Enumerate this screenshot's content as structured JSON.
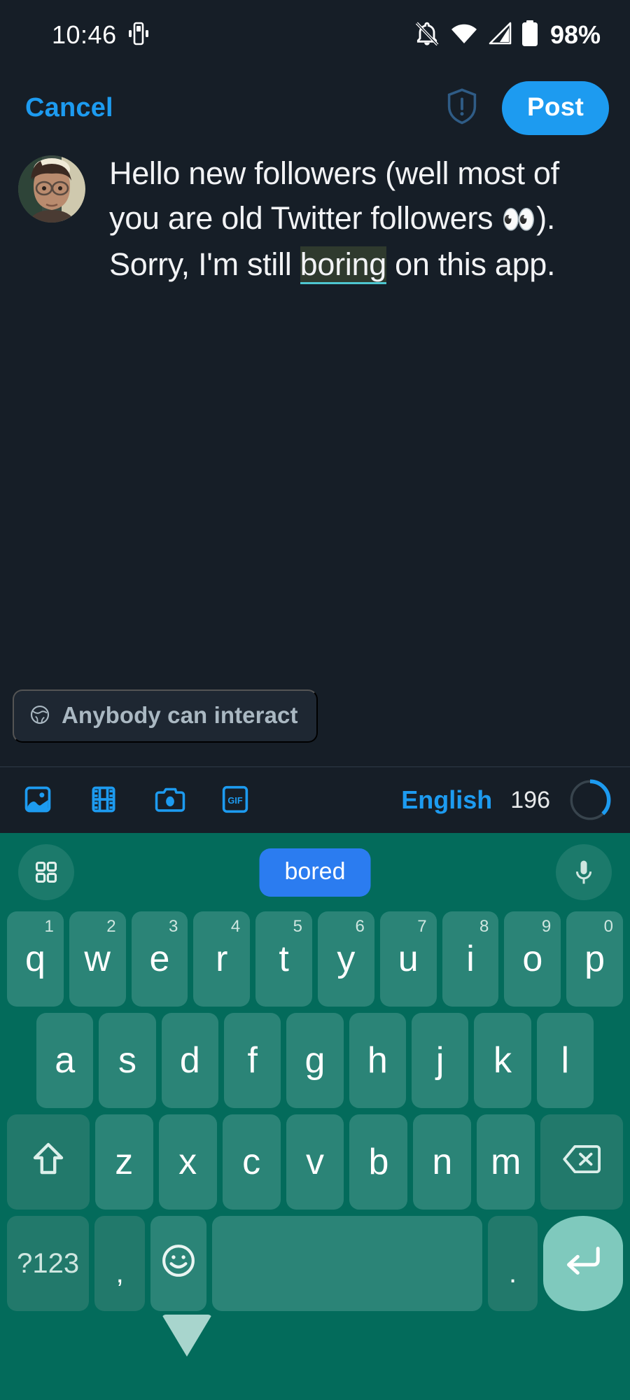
{
  "status_bar": {
    "time": "10:46",
    "battery_percent": "98%",
    "icons": [
      "vibrate-icon",
      "mute-notifications-icon",
      "wifi-icon",
      "cellular-signal-icon",
      "battery-icon"
    ]
  },
  "header": {
    "cancel_label": "Cancel",
    "post_label": "Post",
    "shield_icon": "shield-alert-icon"
  },
  "composer": {
    "avatar_alt": "user-avatar",
    "text_segments": [
      {
        "text": "Hello new followers (well most of you are old Twitter followers ",
        "highlight": false
      },
      {
        "text": "👀",
        "highlight": false,
        "emoji": true
      },
      {
        "text": "). Sorry, I'm still ",
        "highlight": false
      },
      {
        "text": "boring",
        "highlight": true
      },
      {
        "text": " on this app.",
        "highlight": false
      }
    ],
    "full_text": "Hello new followers (well most of you are old Twitter followers 👀). Sorry, I'm still boring on this app.",
    "selected_word": "boring"
  },
  "audience": {
    "icon": "globe-icon",
    "label": "Anybody can interact"
  },
  "toolbar": {
    "tools": [
      {
        "name": "image-icon",
        "label": "Image"
      },
      {
        "name": "video-icon",
        "label": "Video"
      },
      {
        "name": "camera-icon",
        "label": "Camera"
      },
      {
        "name": "gif-icon",
        "label": "GIF"
      }
    ],
    "gif_label": "GIF",
    "language": "English",
    "char_remaining": "196",
    "progress_percent": 38
  },
  "keyboard": {
    "suggestion": "bored",
    "left_icon": "app-grid-icon",
    "right_icon": "microphone-icon",
    "row1": [
      {
        "key": "q",
        "hint": "1"
      },
      {
        "key": "w",
        "hint": "2"
      },
      {
        "key": "e",
        "hint": "3"
      },
      {
        "key": "r",
        "hint": "4"
      },
      {
        "key": "t",
        "hint": "5"
      },
      {
        "key": "y",
        "hint": "6"
      },
      {
        "key": "u",
        "hint": "7"
      },
      {
        "key": "i",
        "hint": "8"
      },
      {
        "key": "o",
        "hint": "9"
      },
      {
        "key": "p",
        "hint": "0"
      }
    ],
    "row2": [
      "a",
      "s",
      "d",
      "f",
      "g",
      "h",
      "j",
      "k",
      "l"
    ],
    "row3_letters": [
      "z",
      "x",
      "c",
      "v",
      "b",
      "n",
      "m"
    ],
    "shift_icon": "shift-arrow-icon",
    "backspace_icon": "backspace-icon",
    "symbols_label": "?123",
    "comma_label": ",",
    "emoji_icon": "emoji-smiley-icon",
    "space_label": "",
    "period_label": ".",
    "enter_icon": "enter-arrow-icon"
  },
  "navbar": {
    "back": "back-nav-button",
    "home": "home-nav-button",
    "recents": "recents-nav-button"
  },
  "colors": {
    "app_bg": "#161e27",
    "accent_blue": "#1d9bf0",
    "keyboard_bg": "#036b5b",
    "key_bg": "#2b8477",
    "suggestion_blue": "#2b7cf0",
    "selection_bg": "#2f3a2e",
    "selection_underline": "#4ec6d0"
  }
}
